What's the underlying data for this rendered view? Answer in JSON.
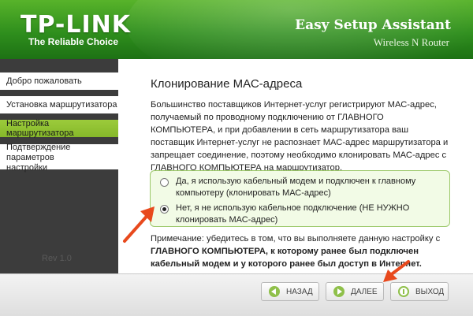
{
  "header": {
    "logo": "TP-LINK",
    "tagline": "The Reliable Choice",
    "title": "Easy Setup Assistant",
    "subtitle": "Wireless N Router"
  },
  "sidebar": {
    "items": [
      {
        "label": "Добро пожаловать"
      },
      {
        "label": "Установка маршрутизатора"
      },
      {
        "label": "Настройка маршрутизатора",
        "active": true
      },
      {
        "label_line1": "Подтверждение параметров",
        "label_line2": "настройки"
      }
    ],
    "rev": "Rev 1.0"
  },
  "main": {
    "title": "Клонирование МАС-адреса",
    "description": "Большинство поставщиков Интернет-услуг регистрируют МАС-адрес, получаемый по проводному подключению от ГЛАВНОГО КОМПЬЮТЕРА, и при добавлении в сеть маршрутизатора ваш поставщик Интернет-услуг не распознает МАС-адрес маршрутизатора и запрещает соединение, поэтому необходимо клонировать МАС-адрес с ГЛАВНОГО КОМПЬЮТЕРА на маршрутизатор.",
    "options": [
      {
        "line1": "Да, я использую кабельный модем и подключен к главному",
        "line2": "компьютеру (клонировать МАС-адрес)",
        "selected": false
      },
      {
        "line1": "Нет, я не использую кабельное подключение (НЕ НУЖНО",
        "line2": "клонировать МАС-адрес)",
        "selected": true
      }
    ],
    "note_prefix": "Примечание: убедитесь в том, что вы выполняете данную настройку с",
    "note_bold": "ГЛАВНОГО КОМПЬЮТЕРА, к которому ранее был подключен кабельный модем и у которого ранее был доступ в Интернет."
  },
  "footer": {
    "back_label": "НАЗАД",
    "next_label": "ДАЛЕЕ",
    "exit_label": "ВЫХОД"
  },
  "colors": {
    "brand_green": "#2f8f1d",
    "active_item": "#9ccb3b",
    "annotation_arrow": "#e8491d"
  }
}
